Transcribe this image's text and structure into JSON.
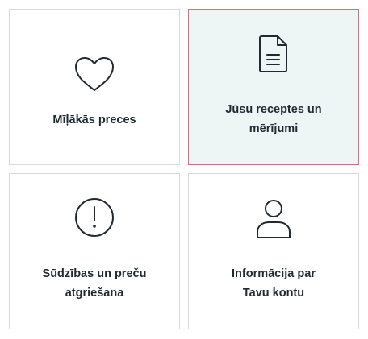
{
  "tiles": [
    {
      "id": "favorites",
      "icon": "heart-icon",
      "lines": [
        "Mīļākās preces"
      ],
      "active": false
    },
    {
      "id": "prescriptions",
      "icon": "document-icon",
      "lines": [
        "Jūsu receptes un",
        "mērījumi"
      ],
      "active": true
    },
    {
      "id": "complaints",
      "icon": "alert-circle-icon",
      "lines": [
        "Sūdzības un preču",
        "atgriešana"
      ],
      "active": false
    },
    {
      "id": "account",
      "icon": "user-icon",
      "lines": [
        "Informācija par",
        "Tavu kontu"
      ],
      "active": false
    }
  ],
  "colors": {
    "border": "#d6dadd",
    "active_border": "#e06b7f",
    "active_background": "#eef5f5",
    "text": "#1f2a33",
    "icon": "#1f2a33"
  }
}
